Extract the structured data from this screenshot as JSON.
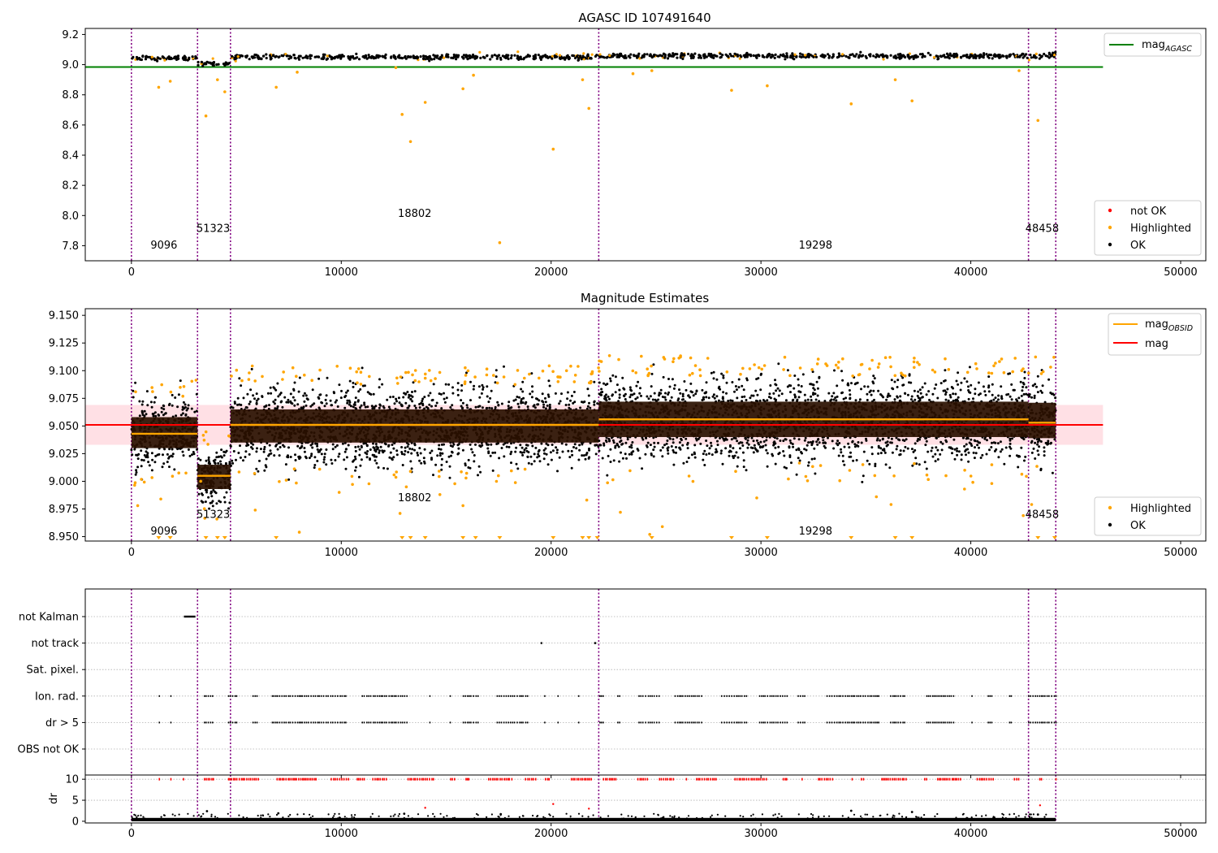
{
  "chart_data": [
    {
      "type": "scatter",
      "title": "AGASC ID 107491640",
      "xlim": [
        -2200,
        51200
      ],
      "ylim": [
        7.7,
        9.24
      ],
      "x_ticks": [
        0,
        10000,
        20000,
        30000,
        40000,
        50000
      ],
      "y_ticks": [
        7.8,
        8.0,
        8.2,
        8.4,
        8.6,
        8.8,
        9.0,
        9.2
      ],
      "x_tick_labels": [
        "0",
        "10000",
        "20000",
        "30000",
        "40000",
        "50000"
      ],
      "y_tick_labels": [
        "7.8",
        "8.0",
        "8.2",
        "8.4",
        "8.6",
        "8.8",
        "9.0",
        "9.2"
      ],
      "obsid_boundaries": [
        0,
        3150,
        4720,
        22270,
        42750,
        44050
      ],
      "obsid_labels": [
        {
          "text": "9096",
          "x": 1550,
          "y": 7.78
        },
        {
          "text": "51323",
          "x": 3900,
          "y": 7.89
        },
        {
          "text": "18802",
          "x": 13500,
          "y": 7.99
        },
        {
          "text": "19298",
          "x": 32600,
          "y": 7.78
        },
        {
          "text": "48458",
          "x": 43400,
          "y": 7.89
        }
      ],
      "mag_agasc": {
        "value": 8.984,
        "x_range": [
          -2200,
          46300
        ]
      },
      "ok_bands": [
        {
          "x": [
            0,
            3150
          ],
          "center": 9.043,
          "halfwidth": 0.012
        },
        {
          "x": [
            3150,
            4720
          ],
          "center": 9.005,
          "halfwidth": 0.012
        },
        {
          "x": [
            4720,
            22270
          ],
          "center": 9.05,
          "halfwidth": 0.014
        },
        {
          "x": [
            22270,
            42750
          ],
          "center": 9.058,
          "halfwidth": 0.014
        },
        {
          "x": [
            42750,
            44050
          ],
          "center": 9.058,
          "halfwidth": 0.016
        }
      ],
      "highlighted_outliers": [
        [
          1300,
          8.85
        ],
        [
          1850,
          8.89
        ],
        [
          3550,
          8.66
        ],
        [
          4100,
          8.9
        ],
        [
          4450,
          8.82
        ],
        [
          6900,
          8.85
        ],
        [
          7900,
          8.95
        ],
        [
          12600,
          8.98
        ],
        [
          12900,
          8.67
        ],
        [
          13300,
          8.49
        ],
        [
          14000,
          8.75
        ],
        [
          15800,
          8.84
        ],
        [
          16300,
          8.93
        ],
        [
          17550,
          7.82
        ],
        [
          20100,
          8.44
        ],
        [
          21500,
          8.9
        ],
        [
          21800,
          8.71
        ],
        [
          23900,
          8.94
        ],
        [
          24800,
          8.96
        ],
        [
          28600,
          8.83
        ],
        [
          30300,
          8.86
        ],
        [
          34300,
          8.74
        ],
        [
          36400,
          8.9
        ],
        [
          37200,
          8.76
        ],
        [
          42300,
          8.96
        ],
        [
          43200,
          8.63
        ]
      ],
      "legend_upper": [
        {
          "label": "mag",
          "subscript": "AGASC",
          "color": "#008000",
          "kind": "line"
        }
      ],
      "legend_lower": [
        {
          "label": "not OK",
          "color": "#ff0000",
          "kind": "point"
        },
        {
          "label": "Highlighted",
          "color": "#ffa500",
          "kind": "point"
        },
        {
          "label": "OK",
          "color": "#000000",
          "kind": "point"
        }
      ],
      "legend_placement": [
        "upper right",
        "lower right"
      ]
    },
    {
      "type": "scatter",
      "title": "Magnitude Estimates",
      "xlim": [
        -2200,
        51200
      ],
      "ylim": [
        8.946,
        9.156
      ],
      "x_ticks": [
        0,
        10000,
        20000,
        30000,
        40000,
        50000
      ],
      "y_ticks": [
        8.95,
        8.975,
        9.0,
        9.025,
        9.05,
        9.075,
        9.1,
        9.125,
        9.15
      ],
      "x_tick_labels": [
        "0",
        "10000",
        "20000",
        "30000",
        "40000",
        "50000"
      ],
      "y_tick_labels": [
        "8.950",
        "8.975",
        "9.000",
        "9.025",
        "9.050",
        "9.075",
        "9.100",
        "9.125",
        "9.150"
      ],
      "obsid_labels": [
        {
          "text": "9096",
          "x": 1550,
          "y": 8.952
        },
        {
          "text": "51323",
          "x": 3900,
          "y": 8.967
        },
        {
          "text": "18802",
          "x": 13500,
          "y": 8.982
        },
        {
          "text": "19298",
          "x": 32600,
          "y": 8.952
        },
        {
          "text": "48458",
          "x": 43400,
          "y": 8.967
        }
      ],
      "mag": {
        "value": 9.051,
        "x_range": [
          -2200,
          46300
        ],
        "band": [
          9.033,
          9.069
        ]
      },
      "mag_obsid": [
        {
          "x": [
            0,
            3150
          ],
          "value": 9.043
        },
        {
          "x": [
            3150,
            4720
          ],
          "value": 9.005
        },
        {
          "x": [
            4720,
            22270
          ],
          "value": 9.051
        },
        {
          "x": [
            22270,
            42750
          ],
          "value": 9.056
        },
        {
          "x": [
            42750,
            44050
          ],
          "value": 9.053
        }
      ],
      "ok_bands": [
        {
          "x": [
            0,
            3150
          ],
          "center": 9.044,
          "core": 0.014,
          "spread": 0.028
        },
        {
          "x": [
            3150,
            4720
          ],
          "center": 9.004,
          "core": 0.011,
          "spread": 0.024
        },
        {
          "x": [
            4720,
            22270
          ],
          "center": 9.05,
          "core": 0.015,
          "spread": 0.032
        },
        {
          "x": [
            22270,
            42750
          ],
          "center": 9.056,
          "core": 0.016,
          "spread": 0.034
        },
        {
          "x": [
            42750,
            44050
          ],
          "center": 9.055,
          "core": 0.016,
          "spread": 0.036
        }
      ],
      "highlighted_points": [
        [
          300,
          8.978
        ],
        [
          1400,
          8.984
        ],
        [
          3300,
          9.0
        ],
        [
          5900,
          8.974
        ],
        [
          8000,
          8.954
        ],
        [
          9900,
          8.99
        ],
        [
          12800,
          8.971
        ],
        [
          13100,
          8.995
        ],
        [
          14700,
          8.988
        ],
        [
          15800,
          8.978
        ],
        [
          21700,
          8.983
        ],
        [
          23300,
          8.972
        ],
        [
          24700,
          8.952
        ],
        [
          25300,
          8.959
        ],
        [
          29800,
          8.985
        ],
        [
          35500,
          8.986
        ],
        [
          36200,
          8.979
        ],
        [
          39700,
          8.993
        ],
        [
          41000,
          8.998
        ],
        [
          42500,
          8.969
        ],
        [
          42900,
          8.979
        ]
      ],
      "clipped_markers_x": [
        1300,
        1850,
        3550,
        4100,
        4450,
        6900,
        12900,
        13300,
        14000,
        15800,
        16400,
        17550,
        20100,
        21500,
        21800,
        22200,
        24800,
        28600,
        30300,
        34300,
        36400,
        37200,
        43200,
        44000
      ],
      "legend_upper": [
        {
          "label": "mag",
          "subscript": "OBSID",
          "color": "#ffa500",
          "kind": "line"
        },
        {
          "label": "mag",
          "subscript": "",
          "color": "#ff0000",
          "kind": "line"
        }
      ],
      "legend_lower": [
        {
          "label": "Highlighted",
          "color": "#ffa500",
          "kind": "point"
        },
        {
          "label": "OK",
          "color": "#000000",
          "kind": "point"
        }
      ],
      "legend_placement": [
        "upper right",
        "lower right"
      ]
    },
    {
      "type": "scatter",
      "title": "",
      "xlim": [
        -2200,
        51200
      ],
      "flag_rows": [
        "not Kalman",
        "not track",
        "Sat. pixel.",
        "Ion. rad.",
        "dr > 5",
        "OBS not OK"
      ],
      "flag_segments": {
        "not Kalman": [
          [
            2500,
            3050
          ]
        ],
        "not track": [
          [
            19500,
            19560
          ],
          [
            22050,
            22150
          ]
        ]
      },
      "dr_ylim": [
        -0.4,
        11
      ],
      "dr_ticks": [
        0,
        5,
        10
      ],
      "dr_tick_labels": [
        "0",
        "5",
        "10"
      ],
      "dr_ylabel": "dr",
      "x_ticks": [
        0,
        10000,
        20000,
        30000,
        40000,
        50000
      ],
      "x_tick_labels": [
        "0",
        "10000",
        "20000",
        "30000",
        "40000",
        "50000"
      ]
    }
  ]
}
